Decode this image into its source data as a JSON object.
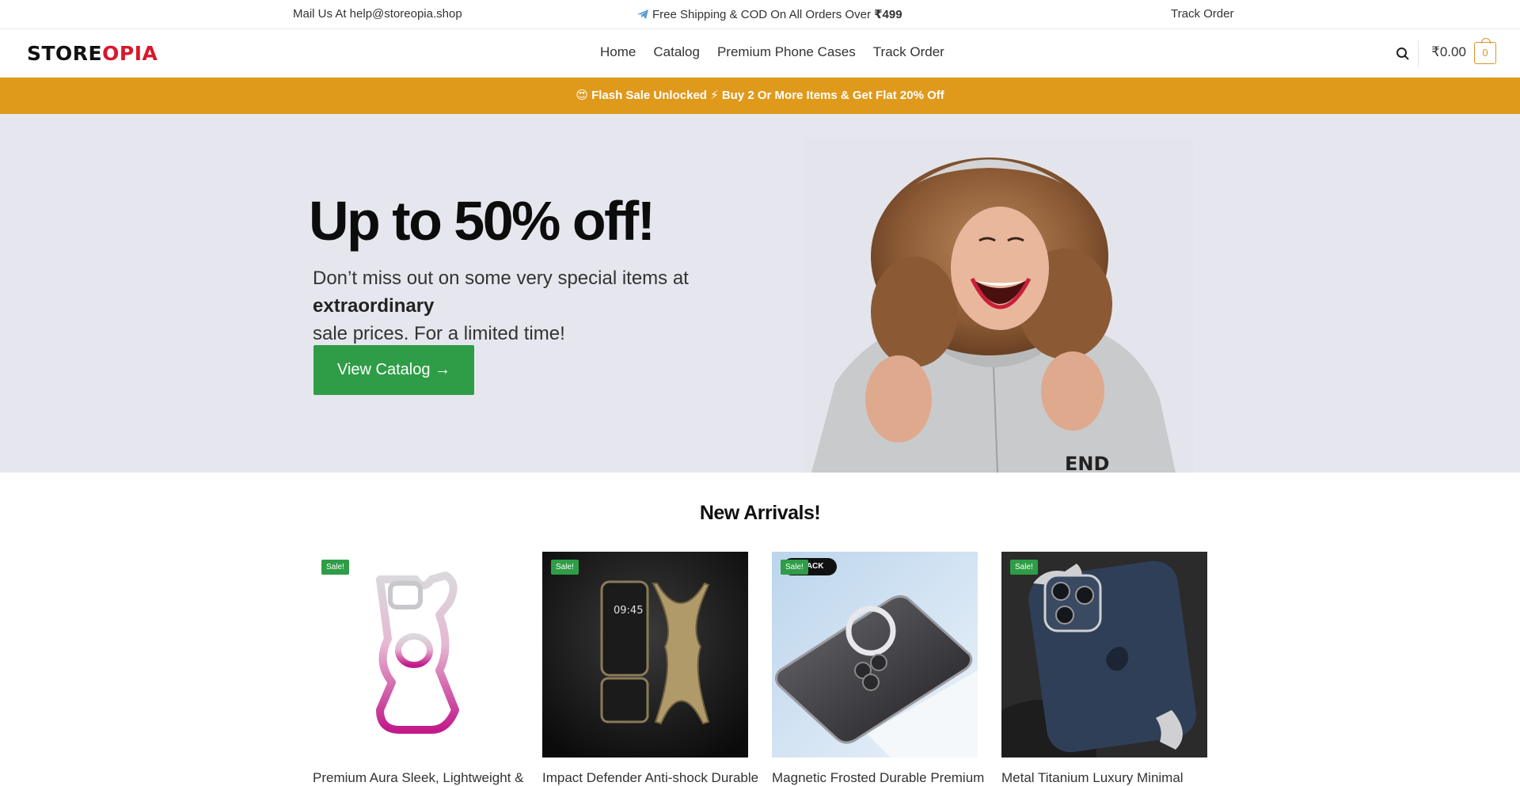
{
  "topbar": {
    "mail": "Mail Us At help@storeopia.shop",
    "shipping_prefix": "Free Shipping & COD On All Orders Over",
    "shipping_amount": "₹499",
    "track": "Track Order"
  },
  "header": {
    "logo_main": "STORE",
    "logo_accent": "OPIA",
    "nav": [
      "Home",
      "Catalog",
      "Premium Phone Cases",
      "Track Order"
    ],
    "cart_total": "₹0.00",
    "cart_count": "0"
  },
  "flash": {
    "emoji": "😍",
    "text1": "Flash Sale Unlocked",
    "bolt": "⚡",
    "text2": "Buy 2 Or More Items & Get Flat 20% Off"
  },
  "hero": {
    "title": "Up to 50% off!",
    "sub_prefix": "Don’t miss out on some very special items at",
    "sub_bold": "extraordinary",
    "sub_suffix": "sale prices. For a limited time!",
    "button": "View Catalog →",
    "shirt_text": "END"
  },
  "arrivals": {
    "title": "New Arrivals!",
    "products": [
      {
        "name": "Premium Aura Sleek, Lightweight &",
        "badge": "Sale!"
      },
      {
        "name": "Impact Defender Anti-shock Durable",
        "badge": "Sale!",
        "screen_time": "09:45"
      },
      {
        "name": "Magnetic Frosted Durable Premium",
        "badge": "Sale!",
        "tag": "BLACK"
      },
      {
        "name": "Metal Titanium Luxury Minimal",
        "badge": "Sale!"
      }
    ]
  },
  "colors": {
    "flash_bg": "#df9a1c",
    "button_green": "#2f9d47",
    "logo_red": "#d8172b",
    "cart_accent": "#d9952b",
    "hero_bg": "#e6e7ee"
  }
}
